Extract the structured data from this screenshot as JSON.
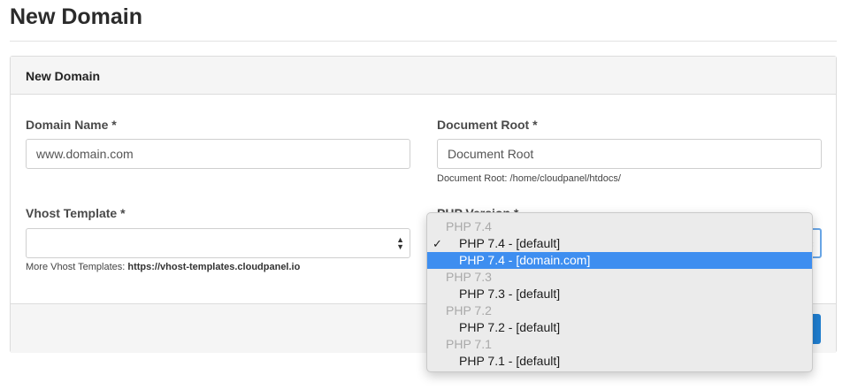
{
  "page": {
    "title": "New Domain"
  },
  "card": {
    "header": "New Domain"
  },
  "form": {
    "domain_name": {
      "label": "Domain Name *",
      "placeholder": "www.domain.com"
    },
    "document_root": {
      "label": "Document Root *",
      "placeholder": "Document Root",
      "help": "Document Root: /home/cloudpanel/htdocs/"
    },
    "vhost_template": {
      "label": "Vhost Template *",
      "value": "",
      "help_prefix": "More Vhost Templates: ",
      "help_link": "https://vhost-templates.cloudpanel.io"
    },
    "php_version": {
      "label": "PHP Version *"
    }
  },
  "dropdown": {
    "groups": [
      {
        "label": "PHP 7.4",
        "options": [
          {
            "label": "PHP 7.4 - [default]",
            "checked": true,
            "highlighted": false
          },
          {
            "label": "PHP 7.4 - [domain.com]",
            "checked": false,
            "highlighted": true
          }
        ]
      },
      {
        "label": "PHP 7.3",
        "options": [
          {
            "label": "PHP 7.3 - [default]",
            "checked": false,
            "highlighted": false
          }
        ]
      },
      {
        "label": "PHP 7.2",
        "options": [
          {
            "label": "PHP 7.2 - [default]",
            "checked": false,
            "highlighted": false
          }
        ]
      },
      {
        "label": "PHP 7.1",
        "options": [
          {
            "label": "PHP 7.1 - [default]",
            "checked": false,
            "highlighted": false
          }
        ]
      }
    ],
    "check_glyph": "✓"
  },
  "colors": {
    "accent": "#1f7ed0",
    "highlight": "#3e8ef0"
  }
}
